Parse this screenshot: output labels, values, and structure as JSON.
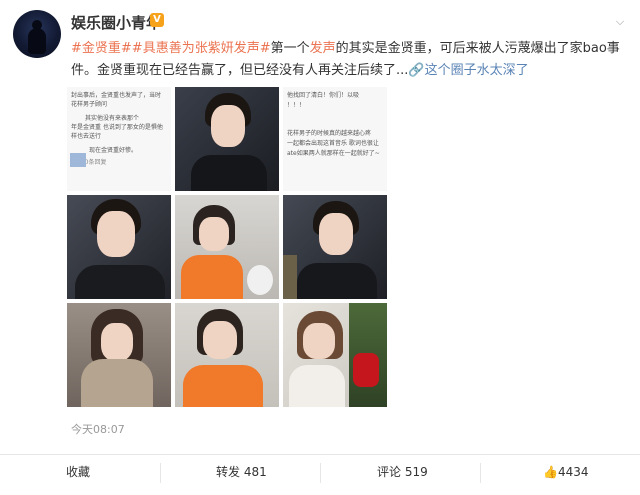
{
  "user": {
    "name": "娱乐圈小青年",
    "badge": "V"
  },
  "post": {
    "tags": [
      "#金贤重#",
      "#具惠善为张紫妍发声#"
    ],
    "text_a": "第一个",
    "keyword": "发声",
    "text_b": "的其实是金贤重，可后来被人污蔑爆出了家bao事件。金贤重现在已经告赢了，但已经没有人再关注后续了...",
    "link_text": "🔗这个圈子水太深了",
    "time": "今天08:07"
  },
  "images": [
    {
      "kind": "text-screenshot",
      "lines": [
        "封出事后，金贤重也发声了，当时",
        "花样男子顾问",
        "其实他没有来表那个",
        "年是金贤重 也说到了那女的是惧他",
        "样也去送行",
        "现在金贤重好惨。",
        "获120条回复"
      ]
    },
    {
      "kind": "photo-man"
    },
    {
      "kind": "text-screenshot-2",
      "lines": [
        "他找回了清白！你们！以吸",
        "！！！",
        "花样男子的时候真的越来越心疼",
        "一起都会出现这首音乐 歌词也很让",
        "ate如果两人就那样在一起就好了~"
      ]
    },
    {
      "kind": "photo-man"
    },
    {
      "kind": "photo-woman-orange"
    },
    {
      "kind": "photo-man"
    },
    {
      "kind": "photo-woman-scarf"
    },
    {
      "kind": "photo-woman-orange"
    },
    {
      "kind": "photo-woman-red"
    }
  ],
  "actions": {
    "fav": "收藏",
    "repost": "转发 481",
    "comment": "评论 519",
    "like": "4434"
  },
  "colors": {
    "tag": "#eb7350",
    "link": "#5a83b5",
    "badge": "#f7a21b"
  }
}
